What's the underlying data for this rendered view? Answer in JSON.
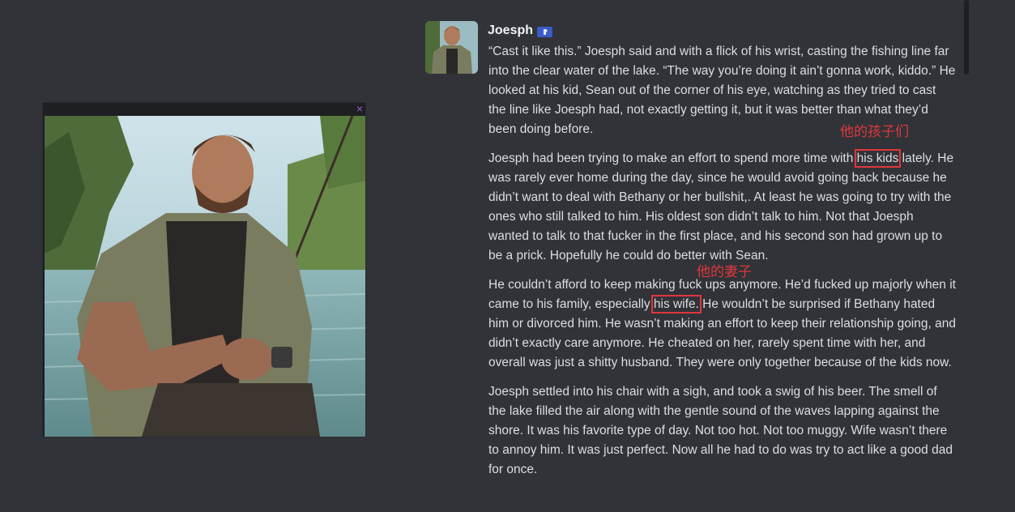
{
  "message": {
    "author": "Joesph",
    "paragraphs": [
      {
        "text": "“Cast it like this.” Joesph said and with a flick of his wrist, casting the fishing line far into the clear water of the lake. “The way you’re doing it ain’t gonna work, kiddo.” He looked at his kid, Sean out of the corner of his eye, watching as they tried to cast the line like Joesph had, not exactly getting it, but it was better than what they’d been doing before."
      },
      {
        "before": "Joesph had been trying to make an effort to spend more time with ",
        "highlight": "his kids",
        "after": " lately. He was rarely ever home during the day, since he would avoid going back because he didn’t want to deal with Bethany or her bullshit,. At least he was going to try with the ones who still talked to him. His oldest son didn’t talk to him. Not that Joesph wanted to talk to that fucker in the first place, and his second son had grown up to be a prick. Hopefully he could do better with Sean."
      },
      {
        "before": "He couldn’t afford to keep making fuck ups anymore. He’d fucked up majorly when it came to his family, especially ",
        "highlight": "his wife.",
        "after": " He wouldn’t be surprised if Bethany hated him or divorced him. He wasn’t making an effort to keep their relationship going, and didn’t exactly care anymore. He cheated on her, rarely spent time with her, and overall was just a shitty husband. They were only together because of the kids now."
      },
      {
        "text": "Joesph settled into his chair with a sigh, and took a swig of his beer. The smell of the lake filled the air along with the gentle sound of the waves lapping against the shore. It was his favorite type of day. Not too hot. Not too muggy. Wife wasn’t there to annoy him. It was just perfect. Now all he had to do was try to act like a good dad for once."
      }
    ]
  },
  "annotations": {
    "kids_note": "他的孩子们",
    "wife_note": "他的妻子"
  },
  "image_panel": {
    "close_label": "×"
  },
  "colors": {
    "background": "#313338",
    "text": "#dbdee1",
    "annotation": "#e0373d",
    "badge": "#3b5cc9"
  }
}
